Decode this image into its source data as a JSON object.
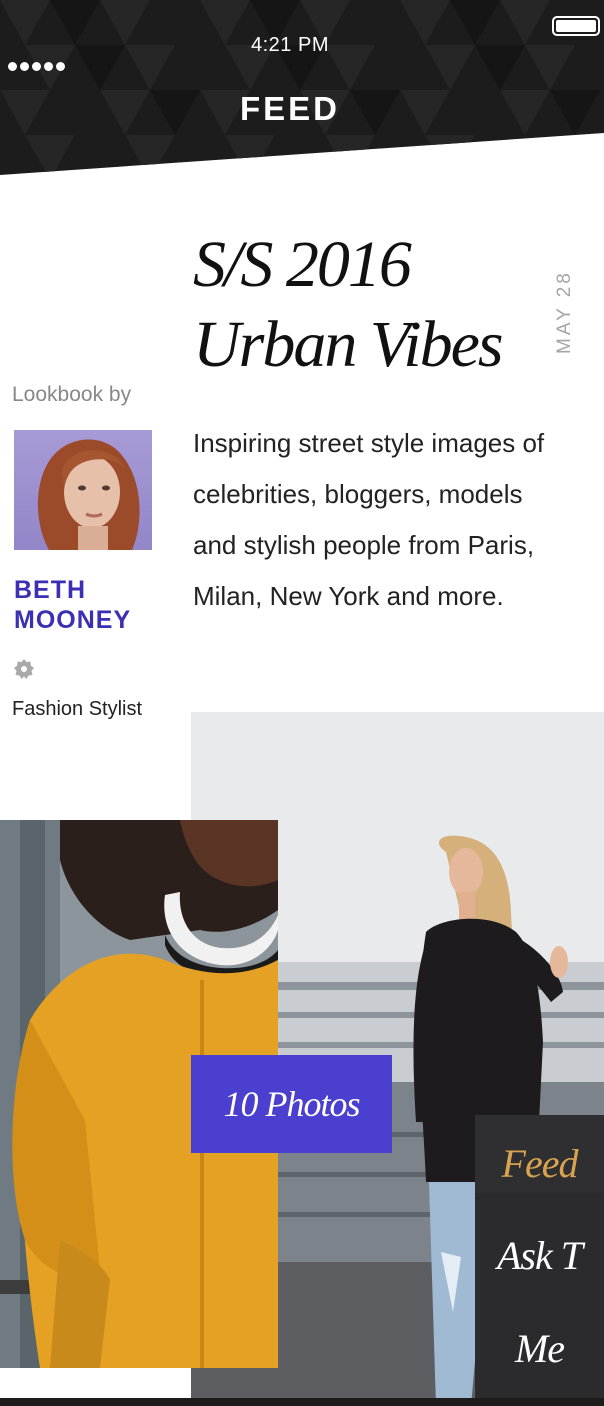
{
  "status_bar": {
    "time": "4:21 PM"
  },
  "header": {
    "title": "FEED"
  },
  "post": {
    "title_line1": "S/S 2016",
    "title_line2": "Urban Vibes",
    "date": "MAY  28",
    "description": "Inspiring street style images of celebrities, bloggers, models and stylish people from Paris, Milan, New York and more.",
    "photos_count": "10 Photos"
  },
  "author": {
    "lookbook_label": "Lookbook by",
    "name_line1": "BETH",
    "name_line2": "MOONEY",
    "role": "Fashion Stylist",
    "badge_icon": "verified-badge-icon"
  },
  "menu": {
    "items": [
      {
        "label": "Feed",
        "active": true
      },
      {
        "label": "Ask T",
        "active": false
      },
      {
        "label": "Me",
        "active": false
      }
    ]
  },
  "colors": {
    "accent": "#4b3fcf",
    "author_name": "#3b2fb3",
    "menu_active": "#d8a350",
    "header_bg": "#1c1c1c"
  }
}
